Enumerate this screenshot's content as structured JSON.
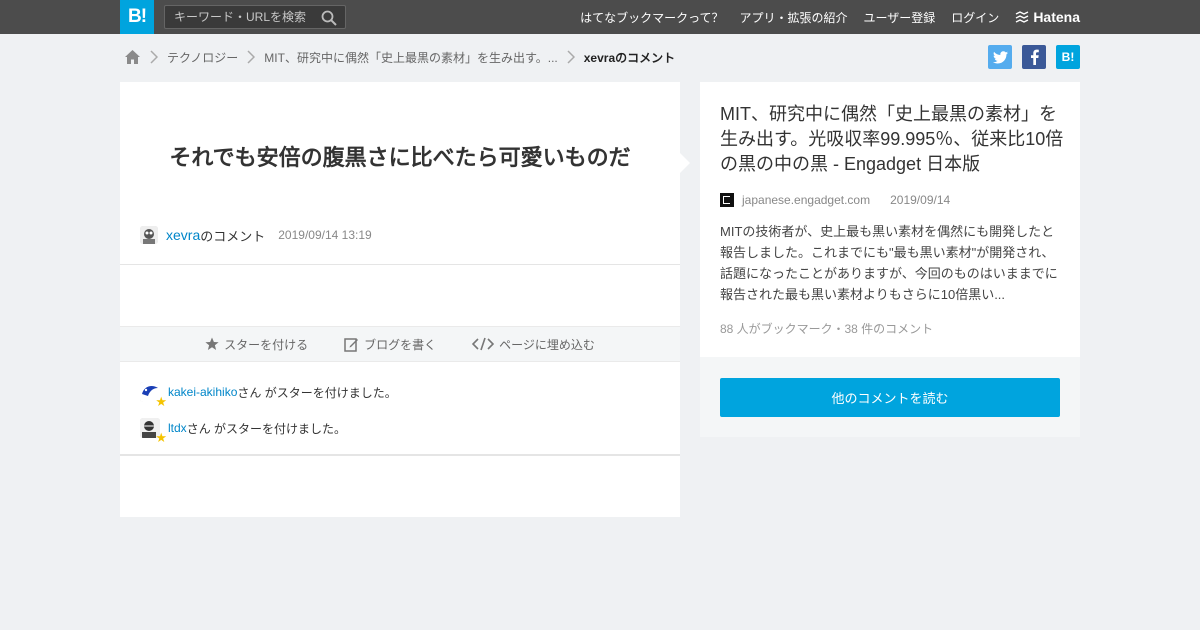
{
  "header": {
    "logo": "B!",
    "search_placeholder": "キーワード・URLを検索",
    "nav": [
      "はてなブックマークって？",
      "アプリ・拡張の紹介",
      "ユーザー登録",
      "ログイン"
    ],
    "brand": "Hatena"
  },
  "breadcrumb": {
    "category": "テクノロジー",
    "entry": "MIT、研究中に偶然「史上最黒の素材」を生み出す。...",
    "current": "xevraのコメント"
  },
  "comment": {
    "text": "それでも安倍の腹黒さに比べたら可愛いものだ",
    "user": "xevra",
    "suffix": "のコメント",
    "timestamp": "2019/09/14 13:19"
  },
  "actions": {
    "star": "スターを付ける",
    "blog": "ブログを書く",
    "embed": "ページに埋め込む"
  },
  "stars": [
    {
      "user": "kakei-akihiko",
      "text": "さん がスターを付けました。"
    },
    {
      "user": "ltdx",
      "text": "さん がスターを付けました。"
    }
  ],
  "entry": {
    "title": "MIT、研究中に偶然「史上最黒の素材」を生み出す。光吸収率99.995％、従来比10倍の黒の中の黒 - Engadget 日本版",
    "domain": "japanese.engadget.com",
    "date": "2019/09/14",
    "summary": "MITの技術者が、史上最も黒い素材を偶然にも開発したと報告しました。これまでにも\"最も黒い素材\"が開発され、話題になったことがありますが、今回のものはいままでに報告された最も黒い素材よりもさらに10倍黒い...",
    "counts": "88 人がブックマーク・38 件のコメント",
    "more_button": "他のコメントを読む"
  },
  "colors": {
    "accent": "#00a4de",
    "header_bg": "#4c4c4c",
    "link": "#0086c9",
    "star": "#f5c400"
  }
}
